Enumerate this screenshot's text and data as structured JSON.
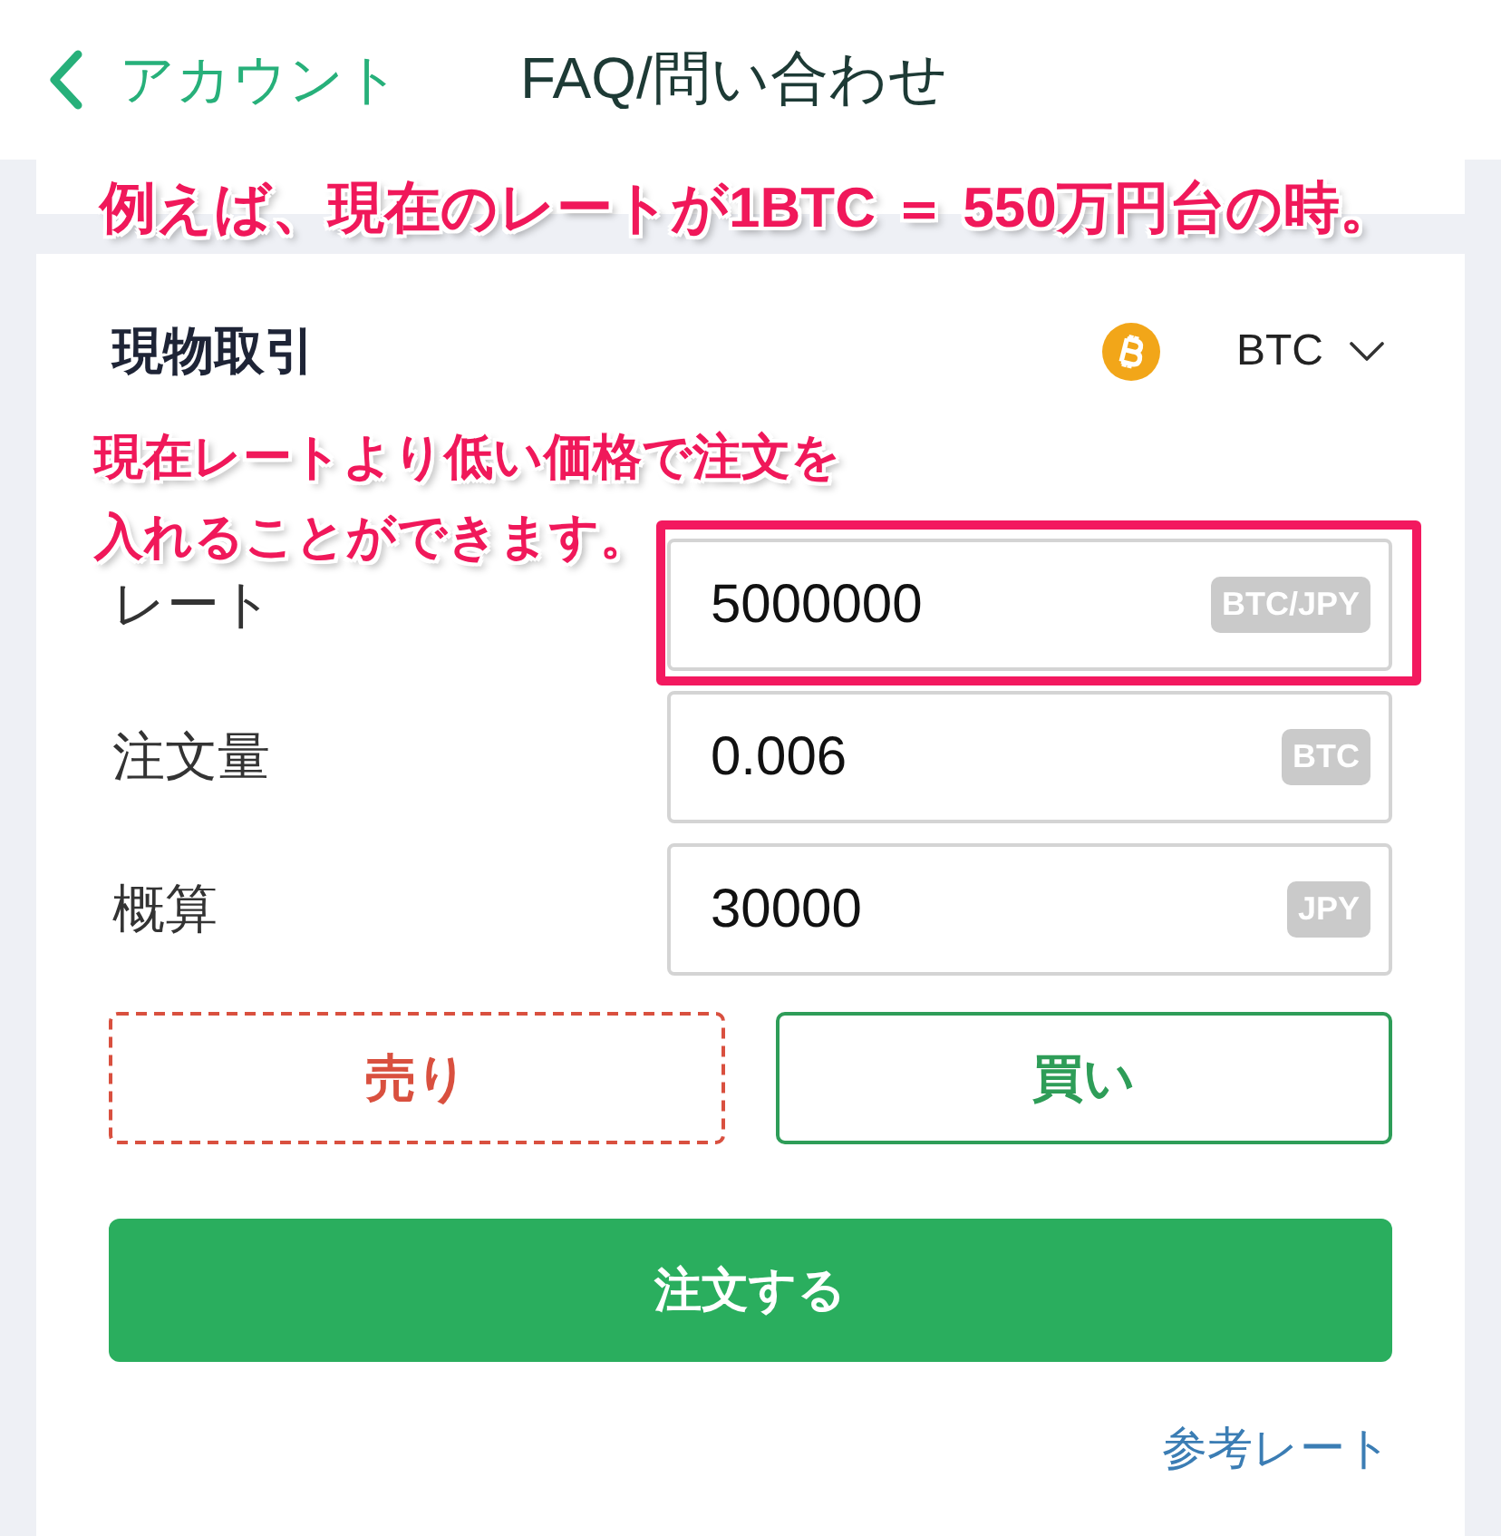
{
  "header": {
    "back_label": "アカウント",
    "title": "FAQ/問い合わせ"
  },
  "banner_note": "例えば、現在のレートが1BTC ＝ 550万円台の時。",
  "order_card": {
    "title": "現物取引",
    "currency": "BTC",
    "note": "現在レートより低い価格で注文を入れることができます。",
    "fields": [
      {
        "label": "レート",
        "value": "5000000",
        "unit": "BTC/JPY",
        "highlighted": true
      },
      {
        "label": "注文量",
        "value": "0.006",
        "unit": "BTC",
        "highlighted": false
      },
      {
        "label": "概算",
        "value": "30000",
        "unit": "JPY",
        "highlighted": false
      }
    ],
    "sides": [
      {
        "label": "売り",
        "selected": false,
        "color": "#d9503f"
      },
      {
        "label": "買い",
        "selected": true,
        "color": "#2e9d58"
      }
    ],
    "submit": "注文する",
    "reference_link": "参考レート"
  }
}
